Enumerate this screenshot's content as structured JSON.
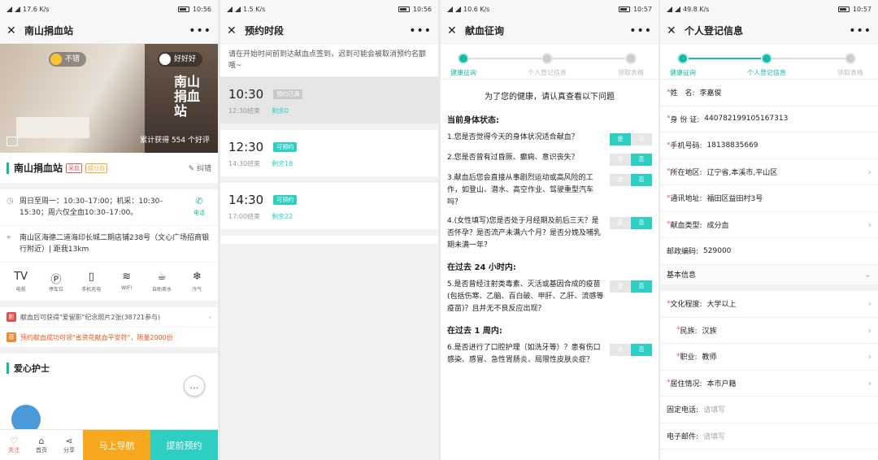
{
  "status": {
    "s1": {
      "net": "17.6 K/s",
      "time": "10:56"
    },
    "s2": {
      "net": "1.5 K/s",
      "time": "10:56"
    },
    "s3": {
      "net": "10.6 K/s",
      "time": "10:57"
    },
    "s4": {
      "net": "49.8 K/s",
      "time": "10:57"
    }
  },
  "screen1": {
    "title": "南山捐血站",
    "hero": {
      "bubble1": "不错",
      "bubble2": "好好好",
      "praise": "累计获得 554 个好评",
      "sign": "南山捐血站"
    },
    "station_name": "南山捐血站",
    "tag1": "采血",
    "tag2": "成分血",
    "edit": "纠错",
    "hours": "周日至周一：10:30–17:00；机采：10:30–15:30；周六仅全血10:30–17:00。",
    "phone_label": "电话",
    "address": "南山区海德二道海印长城二期店铺238号（文心广场招商银行附近）| 距我13km",
    "facilities": [
      {
        "icon": "TV",
        "label": "电视"
      },
      {
        "icon": "Ⓟ",
        "label": "停车位"
      },
      {
        "icon": "▯",
        "label": "手机充电"
      },
      {
        "icon": "≋",
        "label": "WIFI"
      },
      {
        "icon": "☕",
        "label": "自助茶水"
      },
      {
        "icon": "❄",
        "label": "冷气"
      }
    ],
    "notice1": {
      "badge": "影",
      "text": "献血后可获得\"爱留影\"纪念照片2张(38721参与)"
    },
    "notice2": {
      "badge": "荐",
      "text": "预约献血成功可领\"省资花献血平安符\"，限量2000份"
    },
    "nurse_label": "爱心护士",
    "bottom": {
      "follow": "关注",
      "home": "首页",
      "share": "分享",
      "navigate": "马上导航",
      "book": "提前预约"
    }
  },
  "screen2": {
    "title": "预约时段",
    "hint": "请在开始时间前到达献血点签到，迟到可能会被取消预约名额哦~",
    "slots": [
      {
        "time": "10:30",
        "status": "预约已满",
        "end": "12:30结束",
        "remain": "剩余0"
      },
      {
        "time": "12:30",
        "status": "可预约",
        "end": "14:30结束",
        "remain": "剩余18"
      },
      {
        "time": "14:30",
        "status": "可预约",
        "end": "17:00结束",
        "remain": "剩余22"
      }
    ]
  },
  "steps": [
    "健康征询",
    "个人登记信息",
    "领取表格"
  ],
  "screen3": {
    "title": "献血征询",
    "intro": "为了您的健康，请认真查看以下问题",
    "yes": "是",
    "no": "否",
    "sections": [
      {
        "heading": "当前身体状态:",
        "questions": [
          {
            "text": "1.您是否觉得今天的身体状况适合献血？",
            "answer": "yes"
          },
          {
            "text": "2.您是否曾有过昏厥、癫痫、意识丧失？",
            "answer": "no"
          },
          {
            "text": "3.献血后您会直接从事剧烈运动或高风险的工作，如登山、潜水、高空作业、驾驶重型汽车吗？",
            "answer": "no"
          },
          {
            "text": "4.(女性填写)您是否处于月经期及前后三天？是否怀孕？是否流产未满六个月？是否分娩及哺乳期未满一年？",
            "answer": "no"
          }
        ]
      },
      {
        "heading": "在过去 24 小时内:",
        "questions": [
          {
            "text": "5.是否曾经注射类毒素、灭活或基因合成的疫苗(包括伤寒、乙脑、百白破、甲肝、乙肝、流感等疫苗)？且并无不良反应出现？",
            "answer": "no"
          }
        ]
      },
      {
        "heading": "在过去 1 周内:",
        "questions": [
          {
            "text": "6.是否进行了口腔护理（如洗牙等）？患有伤口感染、感冒、急性胃肠炎、局限性皮肤炎症？",
            "answer": "no"
          }
        ]
      }
    ]
  },
  "screen4": {
    "title": "个人登记信息",
    "fields": [
      {
        "label": "姓　名:",
        "value": "李嘉俊",
        "required": true
      },
      {
        "label": "身 份 证:",
        "value": "440782199105167313",
        "required": true
      },
      {
        "label": "手机号码:",
        "value": "18138835669",
        "required": true
      },
      {
        "label": "所在地区:",
        "value": "辽宁省,本溪市,平山区",
        "required": true,
        "arrow": true
      },
      {
        "label": "通讯地址:",
        "value": "福田区益田村3号",
        "required": true
      },
      {
        "label": "献血类型:",
        "value": "成分血",
        "required": true,
        "arrow": true
      },
      {
        "label": "邮政编码:",
        "value": "529000",
        "required": false
      },
      {
        "label": "基本信息",
        "value": "",
        "required": false,
        "arrow": "down",
        "section": true
      },
      {
        "label": "文化程度:",
        "value": "大学以上",
        "required": true,
        "arrow": true
      },
      {
        "label": "民族:",
        "value": "汉族",
        "required": true,
        "arrow": true,
        "sub": true
      },
      {
        "label": "职业:",
        "value": "教师",
        "required": true,
        "arrow": true,
        "sub": true
      },
      {
        "label": "居住情况:",
        "value": "本市户籍",
        "required": true,
        "arrow": true
      },
      {
        "label": "固定电话:",
        "placeholder": "请填写",
        "required": false
      },
      {
        "label": "电子邮件:",
        "placeholder": "请填写",
        "required": false
      }
    ]
  }
}
